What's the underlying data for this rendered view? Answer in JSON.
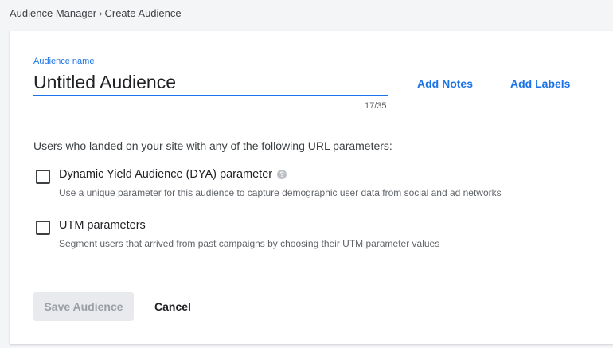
{
  "breadcrumb": {
    "parent": "Audience Manager",
    "separator": "›",
    "current": "Create Audience"
  },
  "form": {
    "name_label": "Audience name",
    "name_value": "Untitled Audience",
    "char_count": "17/35",
    "add_notes": "Add Notes",
    "add_labels": "Add Labels",
    "intro": "Users who landed on your site with any of the following URL parameters:",
    "options": [
      {
        "title": "Dynamic Yield Audience (DYA) parameter",
        "description": "Use a unique parameter for this audience to capture demographic user data from social and ad networks",
        "checked": false,
        "help_icon": "?"
      },
      {
        "title": "UTM parameters",
        "description": "Segment users that arrived from past campaigns by choosing their UTM parameter values",
        "checked": false
      }
    ]
  },
  "actions": {
    "save_label": "Save Audience",
    "save_disabled": true,
    "cancel_label": "Cancel"
  },
  "colors": {
    "accent": "#1a73e8",
    "disabled_bg": "#e8eaed",
    "disabled_text": "#9aa0a6"
  }
}
